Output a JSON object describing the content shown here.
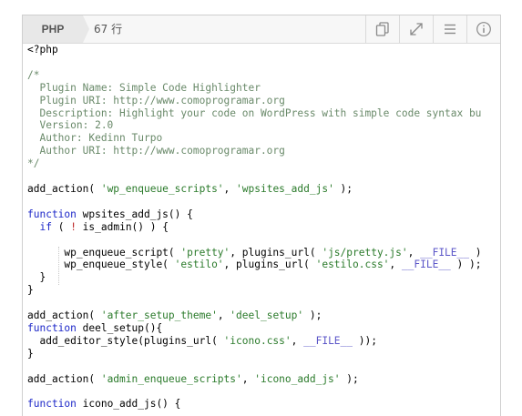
{
  "toolbar": {
    "language": "PHP",
    "line_count": "67 行",
    "buttons": [
      {
        "icon": "copy-icon"
      },
      {
        "icon": "expand-icon"
      },
      {
        "icon": "menu-icon"
      },
      {
        "icon": "info-icon"
      }
    ]
  },
  "code": {
    "lines": [
      "<?php",
      "",
      "/*",
      "  Plugin Name: Simple Code Highlighter",
      "  Plugin URI: http://www.comoprogramar.org",
      "  Description: Highlight your code on WordPress with simple code syntax bu",
      "  Version: 2.0",
      "  Author: Kedinn Turpo",
      "  Author URI: http://www.comoprogramar.org",
      "*/",
      "",
      "add_action( 'wp_enqueue_scripts', 'wpsites_add_js' );",
      "",
      "function wpsites_add_js() {",
      "  if ( ! is_admin() ) {",
      "",
      "      wp_enqueue_script( 'pretty', plugins_url( 'js/pretty.js', __FILE__ ) ",
      "      wp_enqueue_style( 'estilo', plugins_url( 'estilo.css', __FILE__ ) );",
      "  }",
      "}",
      "",
      "add_action( 'after_setup_theme', 'deel_setup' );",
      "function deel_setup(){",
      "  add_editor_style(plugins_url( 'icono.css', __FILE__ ));",
      "}",
      "",
      "add_action( 'admin_enqueue_scripts', 'icono_add_js' );",
      "",
      "function icono_add_js() {"
    ]
  }
}
